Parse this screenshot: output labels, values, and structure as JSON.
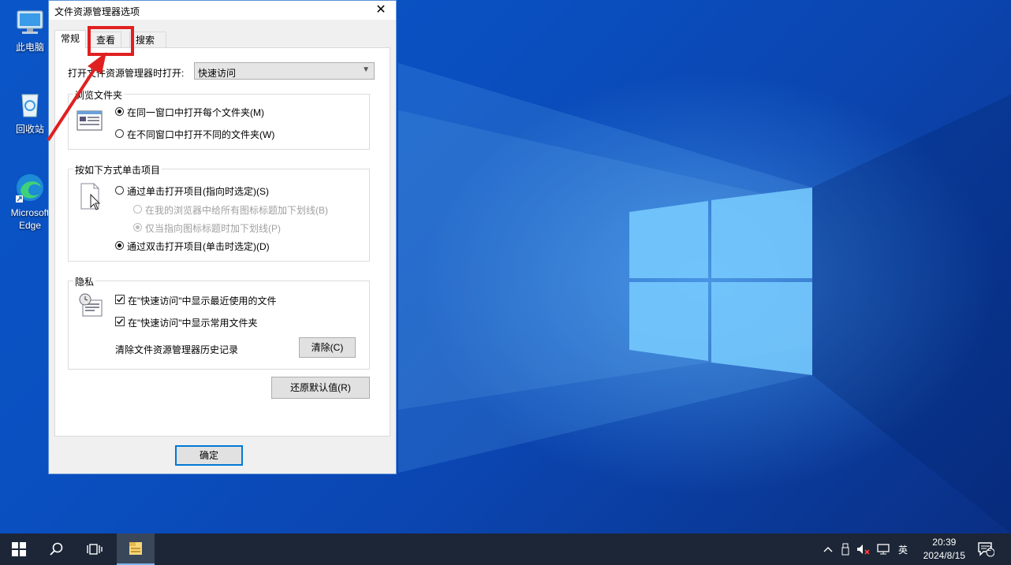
{
  "desktop": {
    "icons": [
      {
        "label": "此电脑"
      },
      {
        "label": "回收站"
      },
      {
        "label": "Microsoft Edge"
      }
    ]
  },
  "dialog": {
    "title": "文件资源管理器选项",
    "close_glyph": "✕",
    "tabs": [
      {
        "label": "常规"
      },
      {
        "label": "查看"
      },
      {
        "label": "搜索"
      }
    ],
    "open_label": "打开文件资源管理器时打开:",
    "open_value": "快速访问",
    "browse_group": {
      "legend": "浏览文件夹",
      "options": [
        {
          "label": "在同一窗口中打开每个文件夹(M)",
          "selected": true
        },
        {
          "label": "在不同窗口中打开不同的文件夹(W)",
          "selected": false
        }
      ]
    },
    "click_group": {
      "legend": "按如下方式单击项目",
      "single": "通过单击打开项目(指向时选定)(S)",
      "sub_options": [
        {
          "label": "在我的浏览器中给所有图标标题加下划线(B)",
          "selected": false
        },
        {
          "label": "仅当指向图标标题时加下划线(P)",
          "selected": true
        }
      ],
      "double": "通过双击打开项目(单击时选定)(D)"
    },
    "privacy_group": {
      "legend": "隐私",
      "checks": [
        {
          "label": "在\"快速访问\"中显示最近使用的文件",
          "checked": true
        },
        {
          "label": "在\"快速访问\"中显示常用文件夹",
          "checked": true
        }
      ],
      "clear_label": "清除文件资源管理器历史记录",
      "clear_button": "清除(C)"
    },
    "restore_button": "还原默认值(R)",
    "ok_button": "确定"
  },
  "taskbar": {
    "clock_time": "20:39",
    "clock_date": "2024/8/15",
    "ime": "英",
    "notification_count": "2"
  },
  "colors": {
    "highlight": "#e02020",
    "accent": "#0078d7",
    "taskbar": "#1c2637"
  }
}
